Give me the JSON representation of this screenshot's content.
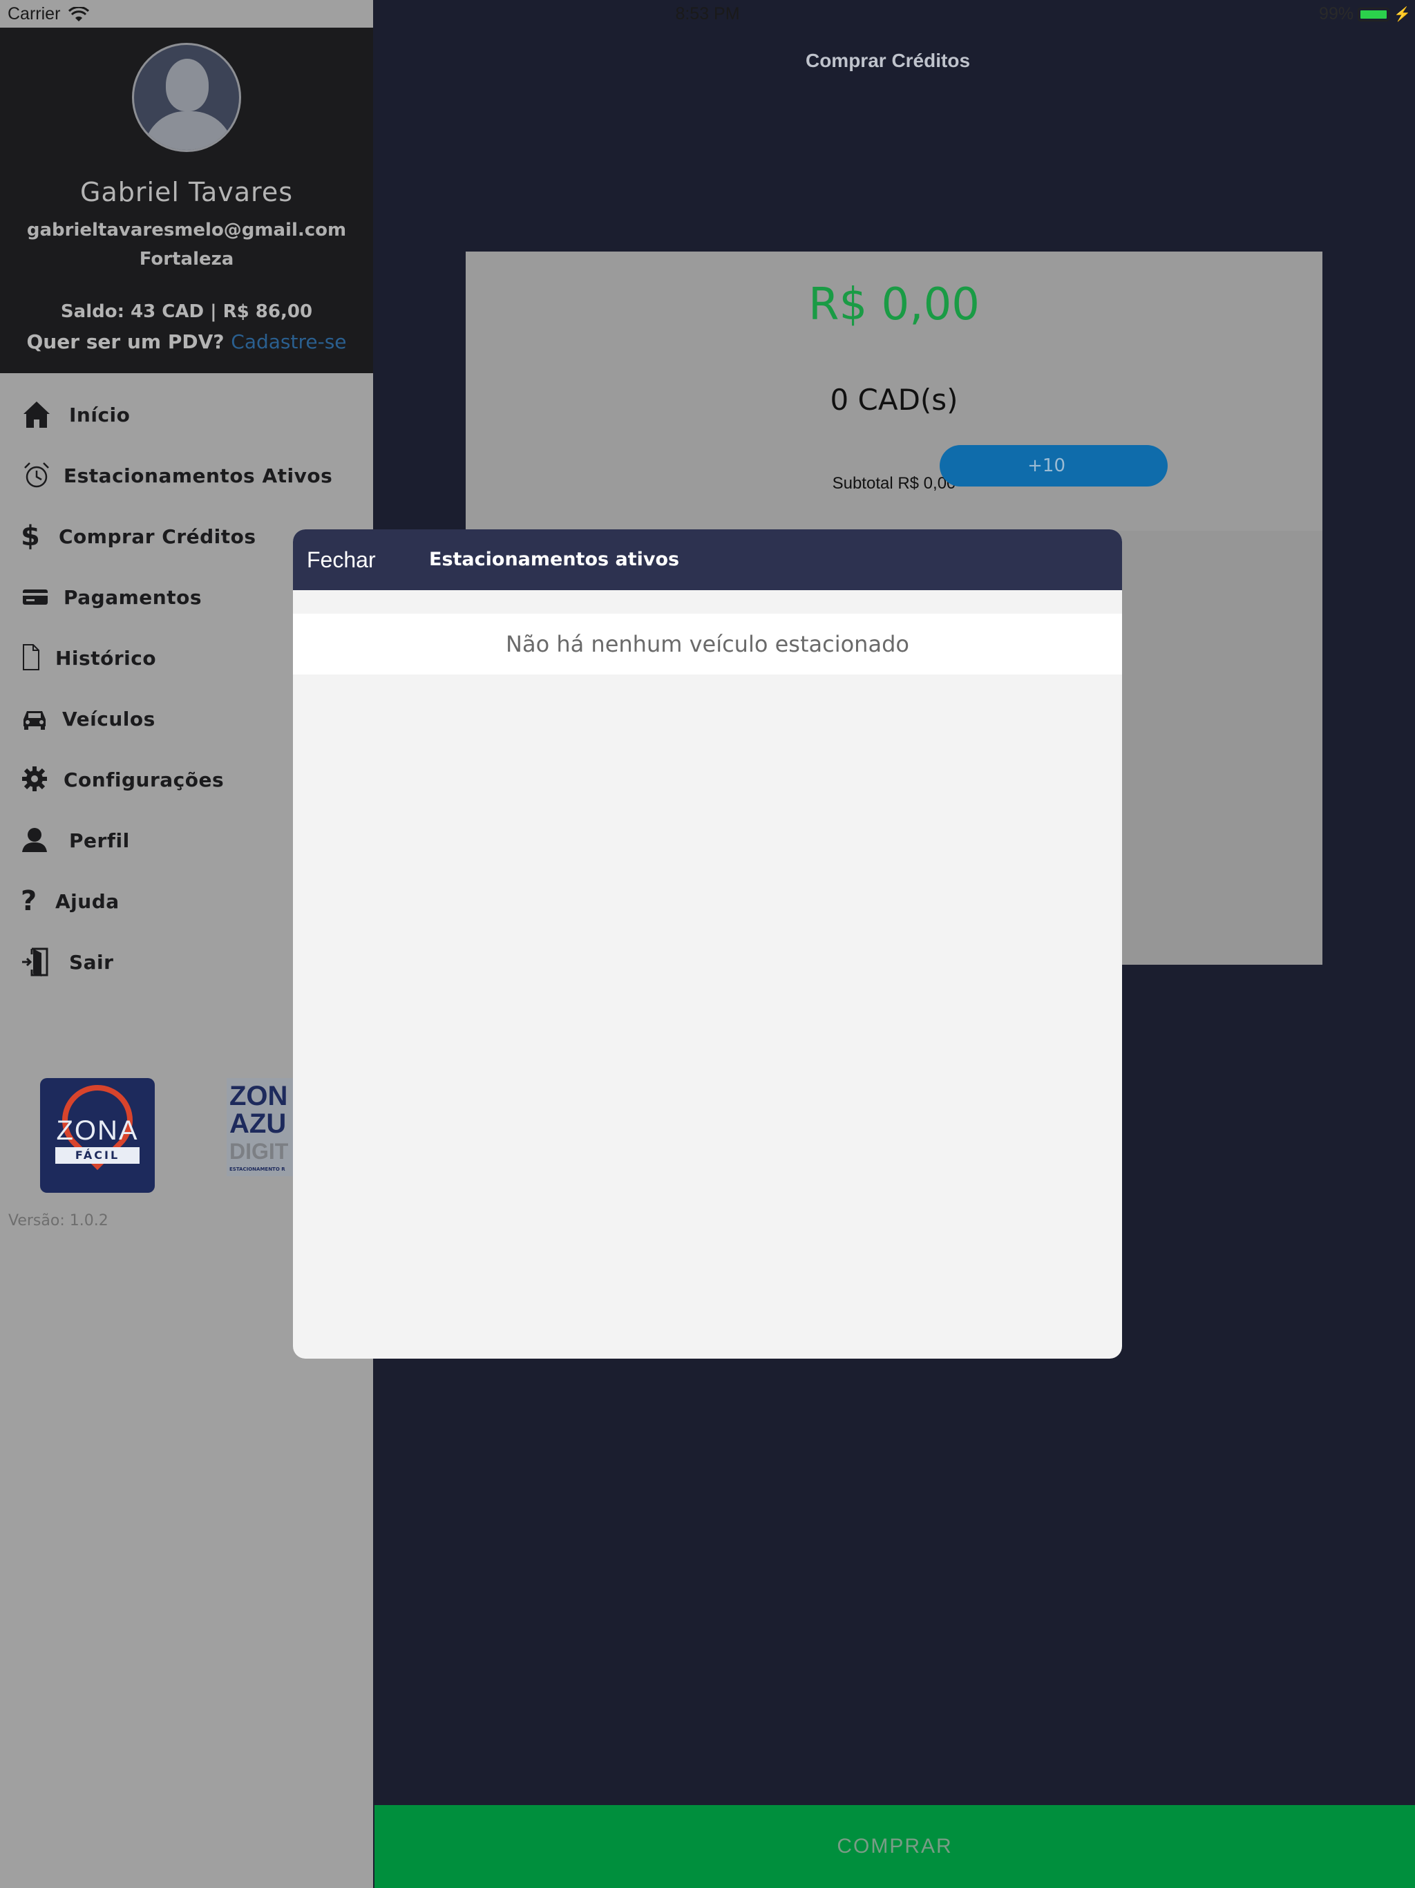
{
  "status_bar": {
    "carrier": "Carrier",
    "time": "8:53 PM",
    "battery": "99%",
    "battery_color": "#2bd14c"
  },
  "main": {
    "title": "Comprar Créditos",
    "price": "R$ 0,00",
    "cads": "0 CAD(s)",
    "subtotal": "Subtotal R$ 0,00",
    "plus_button": "+10",
    "buy_button": "COMPRAR",
    "price_color": "#1a9b45",
    "buy_color": "#008f3d"
  },
  "drawer": {
    "user": {
      "name": "Gabriel Tavares",
      "email": "gabrieltavaresmelo@gmail.com",
      "city": "Fortaleza",
      "saldo": "Saldo: 43 CAD | R$ 86,00",
      "pdv_question": "Quer ser um PDV?",
      "pdv_link": "Cadastre-se"
    },
    "menu": [
      {
        "label": "Início",
        "icon": "home-icon"
      },
      {
        "label": "Estacionamentos Ativos",
        "icon": "alarm-clock-icon"
      },
      {
        "label": "Comprar Créditos",
        "icon": "dollar-icon"
      },
      {
        "label": "Pagamentos",
        "icon": "credit-card-icon"
      },
      {
        "label": "Histórico",
        "icon": "document-icon"
      },
      {
        "label": "Veículos",
        "icon": "car-icon"
      },
      {
        "label": "Configurações",
        "icon": "gear-icon"
      },
      {
        "label": "Perfil",
        "icon": "user-icon"
      },
      {
        "label": "Ajuda",
        "icon": "question-icon"
      },
      {
        "label": "Sair",
        "icon": "exit-door-icon"
      }
    ],
    "logos": {
      "zona_facil_line1": "ZONA",
      "zona_facil_line2": "FÁCIL",
      "zona_azul_line1": "ZON",
      "zona_azul_line2": "AZU",
      "zona_azul_line3": "DIGIT",
      "zona_azul_small": "ESTACIONAMENTO R"
    },
    "version": "Versão: 1.0.2"
  },
  "modal": {
    "close_label": "Fechar",
    "title": "Estacionamentos ativos",
    "empty_message": "Não há nenhum veículo estacionado",
    "header_color": "#2d3250"
  }
}
